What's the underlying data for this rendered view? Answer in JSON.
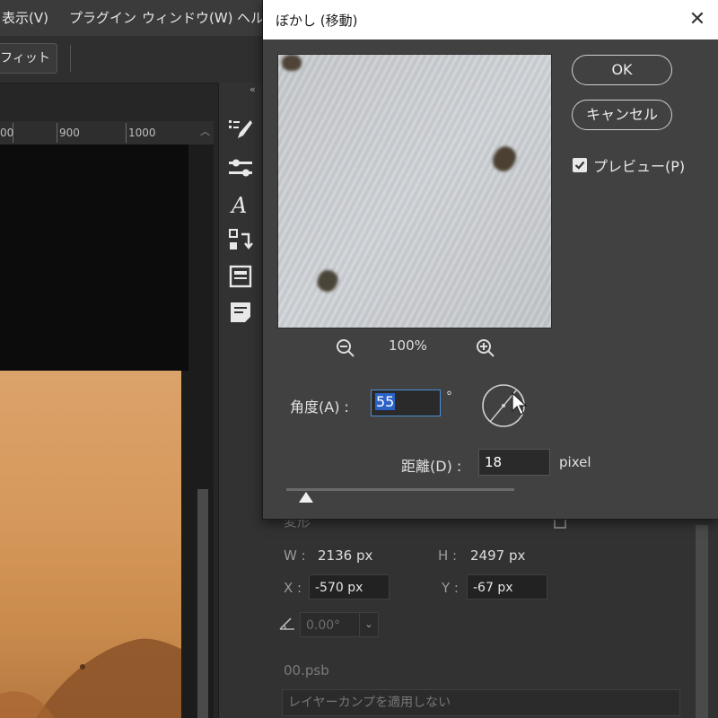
{
  "menubar": {
    "items": [
      "表示(V)",
      "プラグイン",
      "ウィンドウ(W)",
      "ヘル"
    ]
  },
  "optionsbar": {
    "fit_label": "フィット"
  },
  "ruler": {
    "labels": [
      "00",
      "900",
      "1000"
    ]
  },
  "dialog": {
    "title": "ぼかし (移動)",
    "close_glyph": "✕",
    "zoom_level": "100%",
    "ok_label": "OK",
    "cancel_label": "キャンセル",
    "preview_label": "プレビュー(P)",
    "preview_checked": true,
    "angle_label": "角度(A) :",
    "angle_value": "55",
    "degree_symbol": "°",
    "distance_label": "距離(D) :",
    "distance_value": "18",
    "distance_unit": "pixel"
  },
  "properties": {
    "section_label": "変形",
    "w_label": "W :",
    "w_value": "2136 px",
    "h_label": "H :",
    "h_value": "2497 px",
    "x_label": "X :",
    "x_value": "-570 px",
    "y_label": "Y :",
    "y_value": "-67 px",
    "rotation_value": "0.00°",
    "filename": "00.psb",
    "layer_comp": "レイヤーカンプを適用しない"
  },
  "colors": {
    "accent_blue": "#2a62c8",
    "dialog_bg": "#414141",
    "app_bg": "#262626"
  },
  "icons": [
    "close-icon",
    "zoom-out-icon",
    "zoom-in-icon",
    "checkbox-checked-icon",
    "angle-dial-icon",
    "cursor-icon",
    "brush-settings-icon",
    "adjustments-icon",
    "character-icon",
    "history-icon",
    "layers-comp-icon",
    "notes-icon",
    "angle-icon",
    "chevron-down-icon"
  ]
}
